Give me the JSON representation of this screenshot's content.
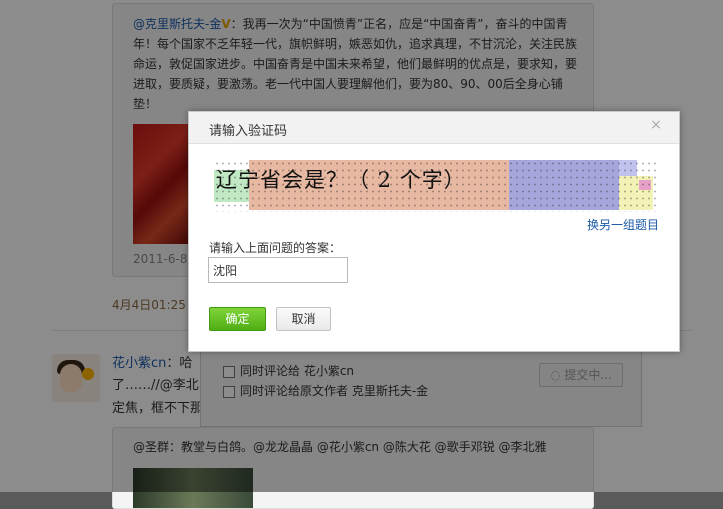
{
  "feed": {
    "quoted_post": {
      "author": "@克里斯托夫-金",
      "text": "：我再一次为“中国愤青”正名，应是“中国奋青”，奋斗的中国青年！每个国家不乏年轻一代，旗帜鲜明，嫉恶如仇，追求真理，不甘沉沦，关注民族命运，敦促国家进步。中国奋青是中国未来希望，他们最鲜明的优点是，要求知，要进取，要质疑，要激荡。老一代中国人要理解他们，要为80、90、00后全身心铺垫！",
      "date": "2011-6-8"
    },
    "post_time": "4月4日01:25",
    "post": {
      "author": "花小紫cn",
      "text_line1": "：哈",
      "text_line2": "了……//@李北",
      "text_line3": "定焦，框不下那"
    },
    "reply_box": {
      "option1": "同时评论给 花小紫cn",
      "option2": "同时评论给原文作者 克里斯托夫-金",
      "submit_label": "提交中..."
    },
    "quoted_post2": {
      "text": "@圣群：教堂与白鸽。@龙龙晶晶 @花小紫cn @陈大花 @歌手邓锐 @李北雅"
    }
  },
  "dialog": {
    "title": "请输入验证码",
    "close_symbol": "×",
    "captcha_text": "辽宁省会是？（ 2 个字）",
    "refresh_link": "换另一组题目",
    "answer_label": "请输入上面问题的答案：",
    "answer_value": "沈阳",
    "confirm_label": "确定",
    "cancel_label": "取消"
  },
  "colors": {
    "confirm_green": "#5cb81f",
    "link_blue": "#1a5aa8"
  }
}
